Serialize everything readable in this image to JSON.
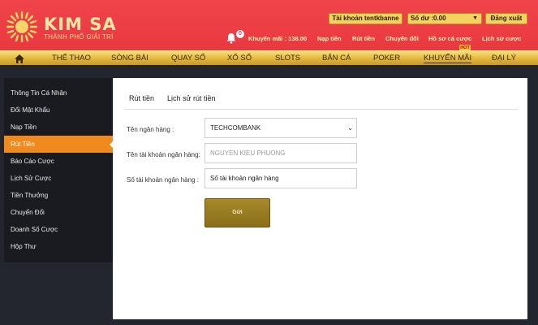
{
  "header": {
    "logo_title": "KIM SA",
    "logo_subtitle": "THÀNH PHỐ GIẢI TRÍ",
    "account_button": "Tài khoản tentkbanne",
    "balance_select": "Số dư :0.00",
    "logout_button": "Đăng xuất",
    "notification_count": "0",
    "promo_balance": "Khuyến mãi : 138.00",
    "links": [
      "Nạp tiền",
      "Rút tiền",
      "Chuyển đổi",
      "Hồ sơ cá cược",
      "Lịch sử cược"
    ],
    "hot_label": "HOT"
  },
  "nav": {
    "items": [
      "THỂ THAO",
      "SÒNG BÀI",
      "QUAY SỐ",
      "XỔ SỐ",
      "SLOTS",
      "BẮN CÁ",
      "POKER",
      "KHUYẾN MÃI",
      "ĐẠI LÝ"
    ]
  },
  "sidebar": {
    "items": [
      "Thông Tin Cá Nhân",
      "Đổi Mật Khẩu",
      "Nạp Tiền",
      "Rút Tiền",
      "Báo Cáo Cược",
      "Lịch Sử Cược",
      "Tiền Thưởng",
      "Chuyển Đổi",
      "Doanh Số Cược",
      "Hộp Thư"
    ],
    "active": "Rút Tiền"
  },
  "main": {
    "tabs": [
      "Rút tiền",
      "Lịch sử rút tiền"
    ],
    "form": {
      "bank_label": "Tên ngân hàng :",
      "bank_value": "TECHCOMBANK",
      "account_name_label": "Tên tài khoản ngân hàng:",
      "account_name_placeholder": "NGUYEN KIEU PHUONG",
      "account_number_label": "Số tài khoản ngân hàng :",
      "account_number_value": "Số tài khoản ngân hàng",
      "submit_label": "Gửi"
    }
  },
  "colors": {
    "header_red": "#e8393f",
    "gold": "#f4d25f",
    "active_orange": "#f08a1d",
    "submit_gold": "#8a6f18"
  }
}
